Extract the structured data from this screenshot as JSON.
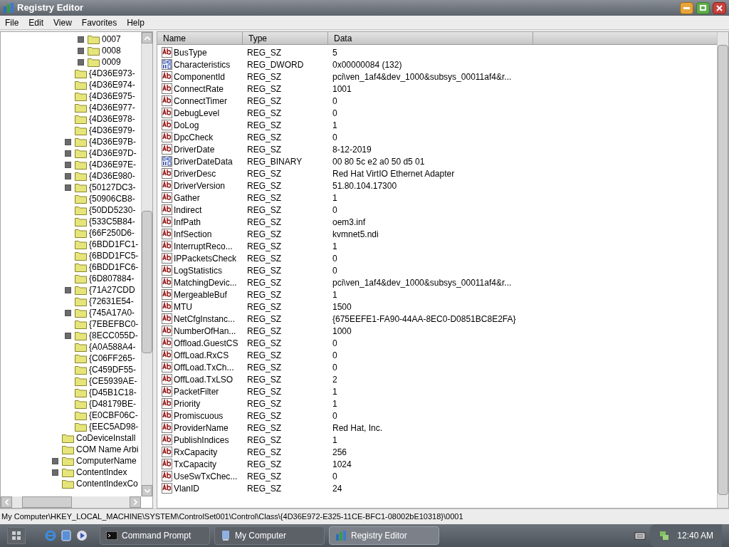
{
  "window": {
    "title": "Registry Editor"
  },
  "menu": [
    "File",
    "Edit",
    "View",
    "Favorites",
    "Help"
  ],
  "tree": [
    {
      "children": [
        {
          "children": [
            {
              "label": "0007",
              "expandable": true
            },
            {
              "label": "0008",
              "expandable": true
            },
            {
              "label": "0009",
              "expandable": true
            }
          ]
        },
        {
          "label": "{4D36E973-",
          "expandable": false
        },
        {
          "label": "{4D36E974-",
          "expandable": false
        },
        {
          "label": "{4D36E975-",
          "expandable": false
        },
        {
          "label": "{4D36E977-",
          "expandable": false
        },
        {
          "label": "{4D36E978-",
          "expandable": false
        },
        {
          "label": "{4D36E979-",
          "expandable": false
        },
        {
          "label": "{4D36E97B-",
          "expandable": true
        },
        {
          "label": "{4D36E97D-",
          "expandable": true
        },
        {
          "label": "{4D36E97E-",
          "expandable": true
        },
        {
          "label": "{4D36E980-",
          "expandable": true
        },
        {
          "label": "{50127DC3-",
          "expandable": true
        },
        {
          "label": "{50906CB8-",
          "expandable": false
        },
        {
          "label": "{50DD5230-",
          "expandable": false
        },
        {
          "label": "{533C5B84-",
          "expandable": false
        },
        {
          "label": "{66F250D6-",
          "expandable": false
        },
        {
          "label": "{6BDD1FC1-",
          "expandable": false
        },
        {
          "label": "{6BDD1FC5-",
          "expandable": false
        },
        {
          "label": "{6BDD1FC6-",
          "expandable": false
        },
        {
          "label": "{6D807884-",
          "expandable": false
        },
        {
          "label": "{71A27CDD",
          "expandable": true
        },
        {
          "label": "{72631E54-",
          "expandable": false
        },
        {
          "label": "{745A17A0-",
          "expandable": true
        },
        {
          "label": "{7EBEFBC0-",
          "expandable": false
        },
        {
          "label": "{8ECC055D-",
          "expandable": true
        },
        {
          "label": "{A0A588A4-",
          "expandable": false
        },
        {
          "label": "{C06FF265-",
          "expandable": false
        },
        {
          "label": "{C459DF55-",
          "expandable": false
        },
        {
          "label": "{CE5939AE-",
          "expandable": false
        },
        {
          "label": "{D45B1C18-",
          "expandable": false
        },
        {
          "label": "{D48179BE-",
          "expandable": false
        },
        {
          "label": "{E0CBF06C-",
          "expandable": false
        },
        {
          "label": "{EEC5AD98-",
          "expandable": false
        }
      ]
    },
    {
      "label": "CoDeviceInstall",
      "expandable": false
    },
    {
      "label": "COM Name Arbi",
      "expandable": false
    },
    {
      "label": "ComputerName",
      "expandable": true
    },
    {
      "label": "ContentIndex",
      "expandable": true
    },
    {
      "label": "ContentIndexCo",
      "expandable": false
    }
  ],
  "table": {
    "columns": [
      "Name",
      "Type",
      "Data"
    ],
    "rows": [
      {
        "kind": "string",
        "name": "BusType",
        "type": "REG_SZ",
        "data": "5"
      },
      {
        "kind": "binary",
        "name": "Characteristics",
        "type": "REG_DWORD",
        "data": "0x00000084 (132)"
      },
      {
        "kind": "string",
        "name": "ComponentId",
        "type": "REG_SZ",
        "data": "pci\\ven_1af4&dev_1000&subsys_00011af4&r..."
      },
      {
        "kind": "string",
        "name": "ConnectRate",
        "type": "REG_SZ",
        "data": "1001"
      },
      {
        "kind": "string",
        "name": "ConnectTimer",
        "type": "REG_SZ",
        "data": "0"
      },
      {
        "kind": "string",
        "name": "DebugLevel",
        "type": "REG_SZ",
        "data": "0"
      },
      {
        "kind": "string",
        "name": "DoLog",
        "type": "REG_SZ",
        "data": "1"
      },
      {
        "kind": "string",
        "name": "DpcCheck",
        "type": "REG_SZ",
        "data": "0"
      },
      {
        "kind": "string",
        "name": "DriverDate",
        "type": "REG_SZ",
        "data": "8-12-2019"
      },
      {
        "kind": "binary",
        "name": "DriverDateData",
        "type": "REG_BINARY",
        "data": "00 80 5c e2 a0 50 d5 01"
      },
      {
        "kind": "string",
        "name": "DriverDesc",
        "type": "REG_SZ",
        "data": "Red Hat VirtIO Ethernet Adapter"
      },
      {
        "kind": "string",
        "name": "DriverVersion",
        "type": "REG_SZ",
        "data": "51.80.104.17300"
      },
      {
        "kind": "string",
        "name": "Gather",
        "type": "REG_SZ",
        "data": "1"
      },
      {
        "kind": "string",
        "name": "Indirect",
        "type": "REG_SZ",
        "data": "0"
      },
      {
        "kind": "string",
        "name": "InfPath",
        "type": "REG_SZ",
        "data": "oem3.inf"
      },
      {
        "kind": "string",
        "name": "InfSection",
        "type": "REG_SZ",
        "data": "kvmnet5.ndi"
      },
      {
        "kind": "string",
        "name": "InterruptReco...",
        "type": "REG_SZ",
        "data": "1"
      },
      {
        "kind": "string",
        "name": "IPPacketsCheck",
        "type": "REG_SZ",
        "data": "0"
      },
      {
        "kind": "string",
        "name": "LogStatistics",
        "type": "REG_SZ",
        "data": "0"
      },
      {
        "kind": "string",
        "name": "MatchingDevic...",
        "type": "REG_SZ",
        "data": "pci\\ven_1af4&dev_1000&subsys_00011af4&r..."
      },
      {
        "kind": "string",
        "name": "MergeableBuf",
        "type": "REG_SZ",
        "data": "1"
      },
      {
        "kind": "string",
        "name": "MTU",
        "type": "REG_SZ",
        "data": "1500"
      },
      {
        "kind": "string",
        "name": "NetCfgInstanc...",
        "type": "REG_SZ",
        "data": "{675EEFE1-FA90-44AA-8EC0-D0851BC8E2FA}"
      },
      {
        "kind": "string",
        "name": "NumberOfHan...",
        "type": "REG_SZ",
        "data": "1000"
      },
      {
        "kind": "string",
        "name": "Offload.GuestCS",
        "type": "REG_SZ",
        "data": "0"
      },
      {
        "kind": "string",
        "name": "OffLoad.RxCS",
        "type": "REG_SZ",
        "data": "0"
      },
      {
        "kind": "string",
        "name": "OffLoad.TxCh...",
        "type": "REG_SZ",
        "data": "0"
      },
      {
        "kind": "string",
        "name": "OffLoad.TxLSO",
        "type": "REG_SZ",
        "data": "2"
      },
      {
        "kind": "string",
        "name": "PacketFilter",
        "type": "REG_SZ",
        "data": "1"
      },
      {
        "kind": "string",
        "name": "Priority",
        "type": "REG_SZ",
        "data": "1"
      },
      {
        "kind": "string",
        "name": "Promiscuous",
        "type": "REG_SZ",
        "data": "0"
      },
      {
        "kind": "string",
        "name": "ProviderName",
        "type": "REG_SZ",
        "data": "Red Hat, Inc."
      },
      {
        "kind": "string",
        "name": "PublishIndices",
        "type": "REG_SZ",
        "data": "1"
      },
      {
        "kind": "string",
        "name": "RxCapacity",
        "type": "REG_SZ",
        "data": "256"
      },
      {
        "kind": "string",
        "name": "TxCapacity",
        "type": "REG_SZ",
        "data": "1024"
      },
      {
        "kind": "string",
        "name": "UseSwTxChec...",
        "type": "REG_SZ",
        "data": "0"
      },
      {
        "kind": "string",
        "name": "VlanID",
        "type": "REG_SZ",
        "data": "24"
      }
    ]
  },
  "status_bar": "My Computer\\HKEY_LOCAL_MACHINE\\SYSTEM\\ControlSet001\\Control\\Class\\{4D36E972-E325-11CE-BFC1-08002bE10318}\\0001",
  "taskbar": {
    "tasks": [
      {
        "label": "Command Prompt",
        "kind": "console",
        "selected": false
      },
      {
        "label": "My Computer",
        "kind": "computer",
        "selected": false
      },
      {
        "label": "Registry Editor",
        "kind": "registry",
        "selected": true
      }
    ],
    "clock": "12:40 AM"
  }
}
